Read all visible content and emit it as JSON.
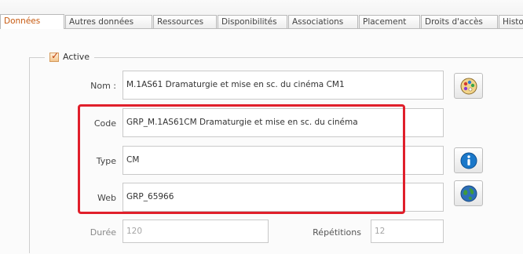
{
  "tabs": [
    {
      "label": "Données",
      "active": true
    },
    {
      "label": "Autres données",
      "active": false
    },
    {
      "label": "Ressources",
      "active": false
    },
    {
      "label": "Disponibilités",
      "active": false
    },
    {
      "label": "Associations",
      "active": false
    },
    {
      "label": "Placement",
      "active": false
    },
    {
      "label": "Droits d'accès",
      "active": false
    },
    {
      "label": "Histo",
      "active": false
    }
  ],
  "group": {
    "checkbox_label": "Active",
    "checked": true
  },
  "fields": {
    "nom": {
      "label": "Nom :",
      "value": "M.1AS61 Dramaturgie et mise en sc. du cinéma CM1"
    },
    "code": {
      "label": "Code",
      "value": "GRP_M.1AS61CM Dramaturgie et mise en sc. du cinéma"
    },
    "type": {
      "label": "Type",
      "value": "CM"
    },
    "web": {
      "label": "Web",
      "value": "GRP_65966"
    },
    "duree": {
      "label": "Durée",
      "value": "120"
    },
    "repetitions": {
      "label": "Répétitions",
      "value": "12"
    }
  },
  "icons": {
    "nom_button": "palette-icon",
    "type_button": "info-icon",
    "web_button": "globe-icon"
  },
  "colors": {
    "highlight": "#e01f2b",
    "active_tab_text": "#c75a10",
    "info_blue": "#1b78c9"
  }
}
